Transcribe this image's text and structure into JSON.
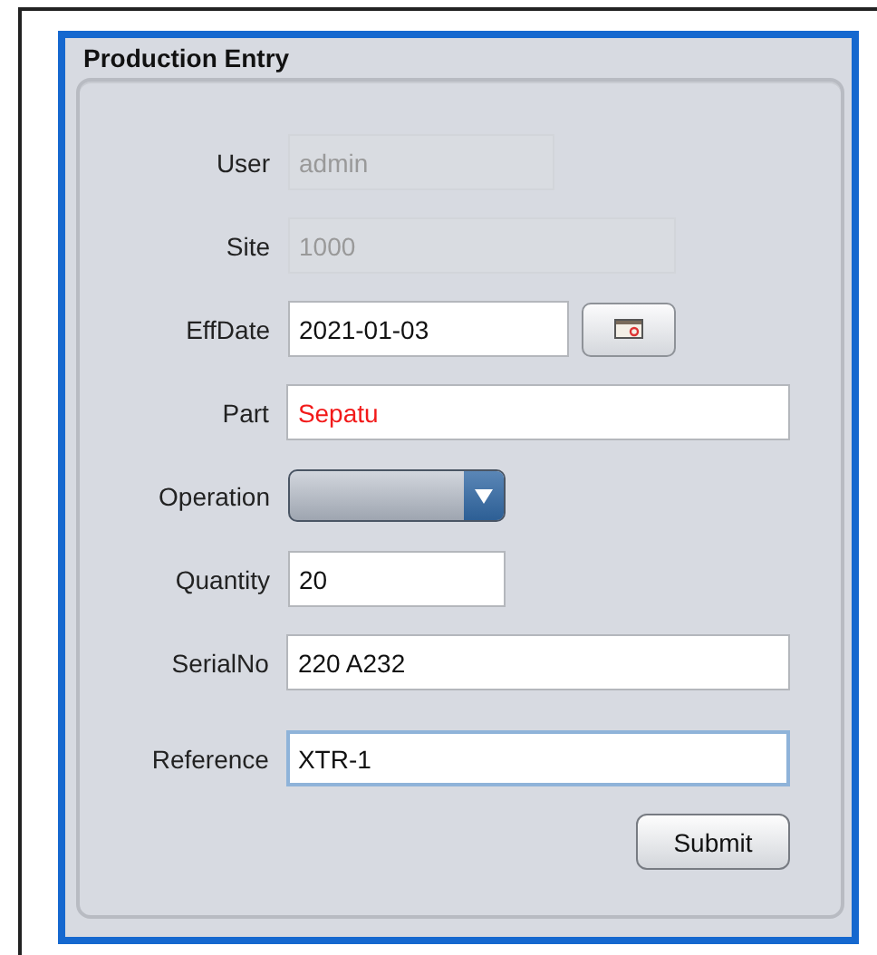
{
  "panel": {
    "title": "Production Entry"
  },
  "fields": [
    {
      "label": "User",
      "kind": "text",
      "value": "admin",
      "disabled": true
    },
    {
      "label": "Site",
      "kind": "text",
      "value": "1000",
      "disabled": true
    },
    {
      "label": "EffDate",
      "kind": "date",
      "value": "2021-01-03",
      "disabled": false
    },
    {
      "label": "Part",
      "kind": "text",
      "value": "Sepatu",
      "disabled": false,
      "invalid": true
    },
    {
      "label": "Operation",
      "kind": "combo",
      "disabled": false
    },
    {
      "label": "Quantity",
      "kind": "text",
      "value": "20",
      "disabled": false
    },
    {
      "label": "SerialNo",
      "kind": "text",
      "value": "220 A232",
      "disabled": false
    },
    {
      "label": "Reference",
      "kind": "text",
      "value": "XTR-1",
      "disabled": false,
      "focused": true
    }
  ],
  "buttons": [
    {
      "label": "Submit"
    }
  ]
}
